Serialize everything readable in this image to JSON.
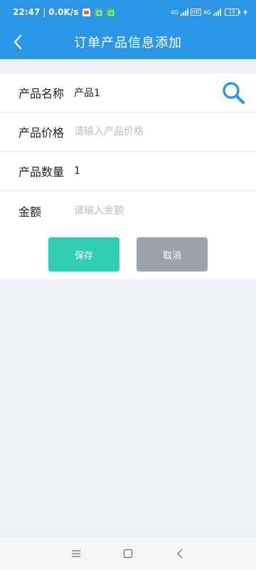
{
  "status_bar": {
    "time": "22:47",
    "net_speed": "0.0K/s",
    "network_1": "4G",
    "network_2": "4G",
    "hd": "HD",
    "battery": "13"
  },
  "header": {
    "title": "订单产品信息添加",
    "back_icon": "chevron-left-icon"
  },
  "form": {
    "product_name": {
      "label": "产品名称",
      "value": "产品1",
      "placeholder": ""
    },
    "product_price": {
      "label": "产品价格",
      "value": "",
      "placeholder": "请输入产品价格"
    },
    "product_quantity": {
      "label": "产品数量",
      "value": "1",
      "placeholder": ""
    },
    "amount": {
      "label": "金额",
      "value": "",
      "placeholder": "请输入金额"
    }
  },
  "buttons": {
    "save_label": "保存",
    "cancel_label": "取消"
  },
  "colors": {
    "header_bg": "#2c96e6",
    "save_bg": "#2ecdb4",
    "cancel_bg": "#9ca3ab",
    "search_icon": "#2c96e6",
    "page_bg": "#edf1f5"
  },
  "icons": {
    "search": "search-icon",
    "nav_menu": "menu-icon",
    "nav_home": "square-home-icon",
    "nav_back": "chevron-left-icon"
  }
}
